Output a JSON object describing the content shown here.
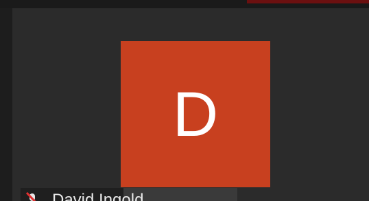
{
  "participant": {
    "initial": "D",
    "tile_color": "#c8401f",
    "name": "David Ingold"
  },
  "icons": {
    "mic_status": "mic-muted-icon"
  }
}
